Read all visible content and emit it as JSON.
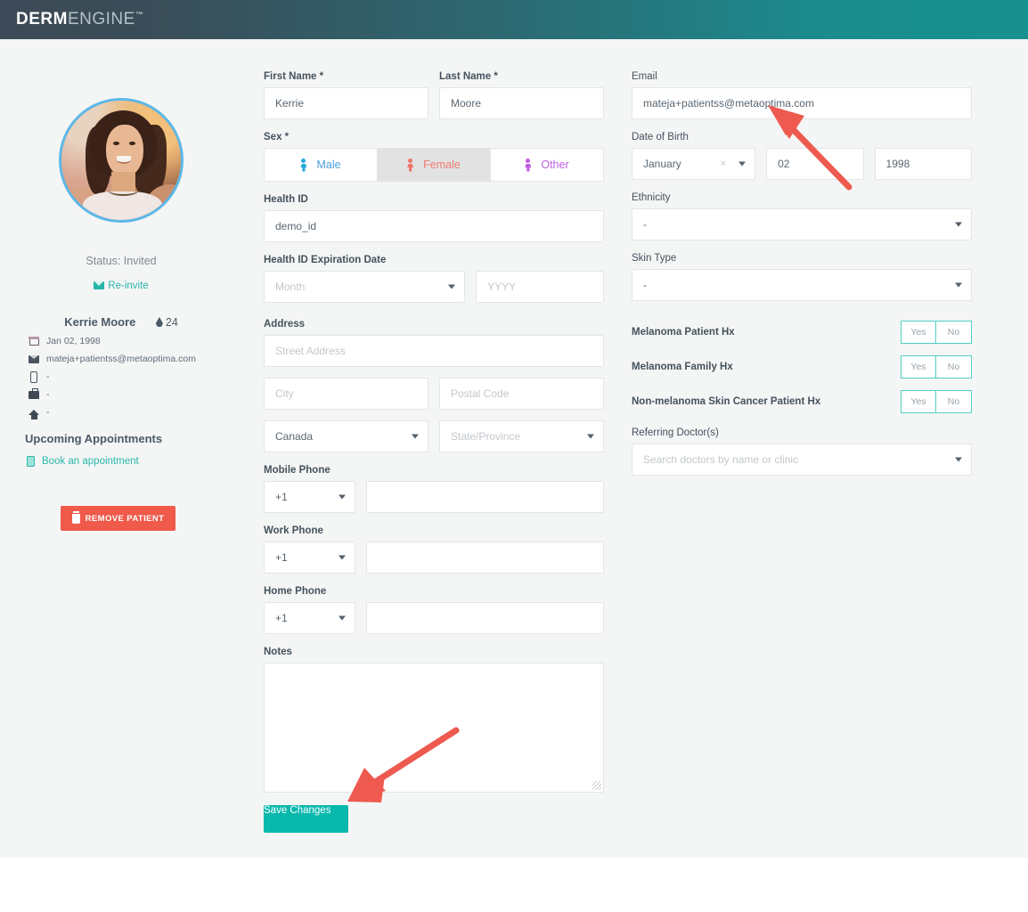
{
  "header": {
    "brand_bold": "DERM",
    "brand_light": "ENGINE",
    "trademark": "™"
  },
  "sidebar": {
    "avatar_alt": "patient-photo",
    "status": "Status: Invited",
    "reinvite_label": "Re-invite",
    "patient_name": "Kerrie Moore",
    "patient_age": "24",
    "info": [
      {
        "icon": "calendar-icon",
        "value": "Jan 02, 1998"
      },
      {
        "icon": "mail-icon",
        "value": "mateja+patientss@metaoptima.com"
      },
      {
        "icon": "mobile-phone-icon",
        "value": "-"
      },
      {
        "icon": "briefcase-icon",
        "value": "-"
      },
      {
        "icon": "home-icon",
        "value": "-"
      }
    ],
    "upcoming_title": "Upcoming Appointments",
    "book_link": "Book an appointment",
    "remove_button": "REMOVE PATIENT"
  },
  "form": {
    "first_name": {
      "label": "First Name *",
      "value": "Kerrie"
    },
    "last_name": {
      "label": "Last Name *",
      "value": "Moore"
    },
    "sex": {
      "label": "Sex *",
      "options": [
        "Male",
        "Female",
        "Other"
      ],
      "selected": "Female"
    },
    "health_id": {
      "label": "Health ID",
      "value": "demo_id"
    },
    "health_id_expiry": {
      "label": "Health ID Expiration Date",
      "month_placeholder": "Month",
      "year_placeholder": "YYYY"
    },
    "address": {
      "label": "Address",
      "street_placeholder": "Street Address",
      "city_placeholder": "City",
      "postal_placeholder": "Postal Code",
      "country_value": "Canada",
      "state_placeholder": "State/Province"
    },
    "mobile_phone": {
      "label": "Mobile Phone",
      "code": "+1",
      "value": ""
    },
    "work_phone": {
      "label": "Work Phone",
      "code": "+1",
      "value": ""
    },
    "home_phone": {
      "label": "Home Phone",
      "code": "+1",
      "value": ""
    },
    "notes": {
      "label": "Notes",
      "value": ""
    },
    "save_button": "Save Changes",
    "email": {
      "label": "Email",
      "value": "mateja+patientss@metaoptima.com"
    },
    "dob": {
      "label": "Date of Birth",
      "month": "January",
      "day": "02",
      "year": "1998"
    },
    "ethnicity": {
      "label": "Ethnicity",
      "value": "-"
    },
    "skin_type": {
      "label": "Skin Type",
      "value": "-"
    },
    "history": [
      {
        "label": "Melanoma Patient Hx",
        "yes": "Yes",
        "no": "No"
      },
      {
        "label": "Melanoma Family Hx",
        "yes": "Yes",
        "no": "No"
      },
      {
        "label": "Non-melanoma Skin Cancer Patient Hx",
        "yes": "Yes",
        "no": "No"
      }
    ],
    "referring_doctors": {
      "label": "Referring Doctor(s)",
      "placeholder": "Search doctors by name or clinic"
    }
  },
  "colors": {
    "brand_teal": "#09b8ad",
    "header_dark": "#3c4b57",
    "header_teal": "#17918f",
    "danger_red": "#ef5a4a",
    "annotation_red": "#ee5a4f",
    "male_blue": "#29a8dd",
    "female_pink": "#f0746a",
    "other_purple": "#c15ae3"
  }
}
